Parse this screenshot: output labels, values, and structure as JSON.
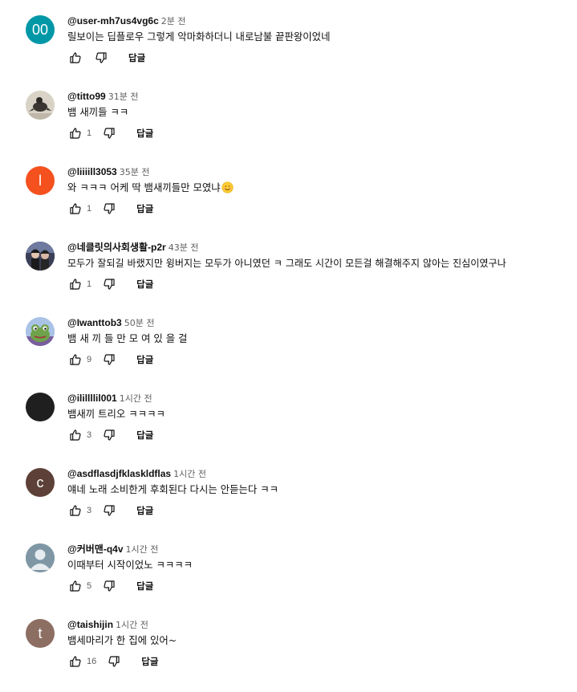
{
  "comments": [
    {
      "author": "@user-mh7us4vg6c",
      "time": "2분 전",
      "text": "릴보이는 딥플로우 그렇게 악마화하더니 내로남불 끝판왕이었네",
      "likes": "",
      "reply_label": "답글",
      "avatar": {
        "type": "initial",
        "text": "00",
        "color": "#0097a7"
      }
    },
    {
      "author": "@titto99",
      "time": "31분 전",
      "text": "뱀 새끼들 ㅋㅋ",
      "likes": "1",
      "reply_label": "답글",
      "avatar": {
        "type": "image",
        "icon": "bird-photo-icon"
      }
    },
    {
      "author": "@liiiill3053",
      "time": "35분 전",
      "text": "와 ㅋㅋㅋ 어케 딱 뱀새끼들만 모였냐",
      "emoji": "smiling-face-emoji",
      "likes": "1",
      "reply_label": "답글",
      "avatar": {
        "type": "initial",
        "text": "l",
        "color": "#f4511e"
      }
    },
    {
      "author": "@네클릿의사회생활-p2r",
      "time": "43분 전",
      "text": "모두가 잘되길 바랬지만 윙버지는 모두가 아니였던 ㅋ 그래도 시간이 모든걸 해결해주지 않아는 진심이였구나",
      "likes": "1",
      "reply_label": "답글",
      "avatar": {
        "type": "image",
        "icon": "two-people-photo-icon"
      }
    },
    {
      "author": "@Iwanttob3",
      "time": "50분 전",
      "text": "뱀 새 끼 들 만 모 여 있 을 걸",
      "likes": "9",
      "reply_label": "답글",
      "avatar": {
        "type": "image",
        "icon": "frog-cartoon-icon"
      }
    },
    {
      "author": "@ilillllil001",
      "time": "1시간 전",
      "text": "뱀새끼 트리오 ㅋㅋㅋㅋ",
      "likes": "3",
      "reply_label": "답글",
      "avatar": {
        "type": "initial",
        "text": "",
        "color": "#1f1f1f"
      }
    },
    {
      "author": "@asdflasdjfklaskldflas",
      "time": "1시간 전",
      "text": "얘네 노래 소비한게 후회된다 다시는 안듣는다 ㅋㅋ",
      "likes": "3",
      "reply_label": "답글",
      "avatar": {
        "type": "initial",
        "text": "c",
        "color": "#5d4037"
      }
    },
    {
      "author": "@커버맨-q4v",
      "time": "1시간 전",
      "text": "이때부터 시작이었노 ㅋㅋㅋㅋ",
      "likes": "5",
      "reply_label": "답글",
      "avatar": {
        "type": "image",
        "icon": "default-person-icon"
      }
    },
    {
      "author": "@taishijin",
      "time": "1시간 전",
      "text": "뱀세마리가 한 집에 있어~",
      "likes": "16",
      "reply_label": "답글",
      "avatar": {
        "type": "initial",
        "text": "t",
        "color": "#8d6e63"
      }
    }
  ]
}
